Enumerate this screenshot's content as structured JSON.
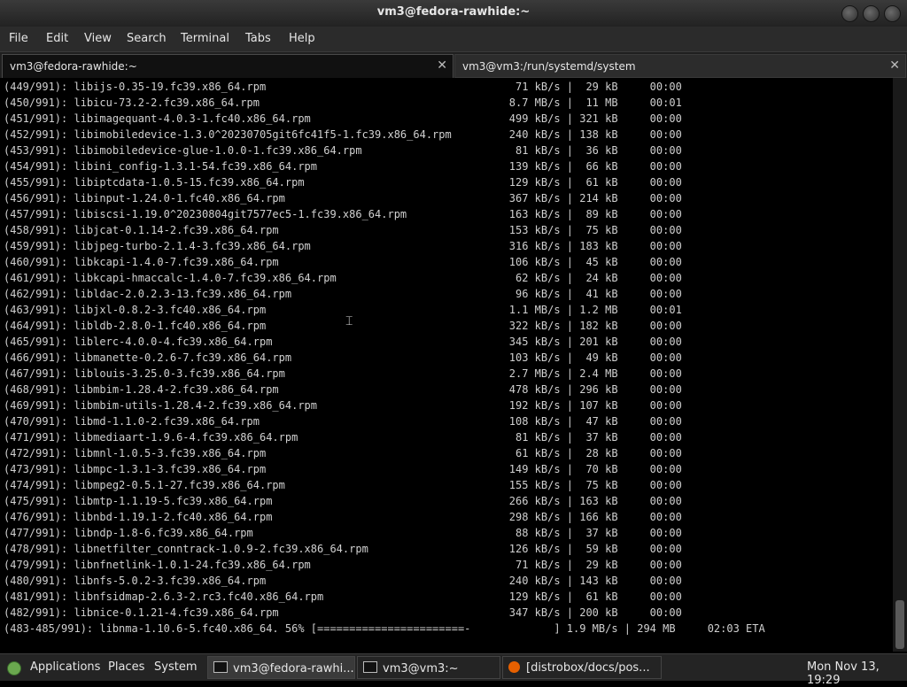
{
  "window": {
    "title": "vm3@fedora-rawhide:~"
  },
  "menu": [
    "File",
    "Edit",
    "View",
    "Search",
    "Terminal",
    "Tabs",
    "Help"
  ],
  "tabs": [
    {
      "label": "vm3@fedora-rawhide:~",
      "close": "✕"
    },
    {
      "label": "vm3@vm3:/run/systemd/system",
      "close": "✕"
    }
  ],
  "terminal": {
    "lines": [
      "(449/991): libijs-0.35-19.fc39.x86_64.rpm                                       71 kB/s |  29 kB     00:00",
      "(450/991): libicu-73.2-2.fc39.x86_64.rpm                                       8.7 MB/s |  11 MB     00:01",
      "(451/991): libimagequant-4.0.3-1.fc40.x86_64.rpm                               499 kB/s | 321 kB     00:00",
      "(452/991): libimobiledevice-1.3.0^20230705git6fc41f5-1.fc39.x86_64.rpm         240 kB/s | 138 kB     00:00",
      "(453/991): libimobiledevice-glue-1.0.0-1.fc39.x86_64.rpm                        81 kB/s |  36 kB     00:00",
      "(454/991): libini_config-1.3.1-54.fc39.x86_64.rpm                              139 kB/s |  66 kB     00:00",
      "(455/991): libiptcdata-1.0.5-15.fc39.x86_64.rpm                                129 kB/s |  61 kB     00:00",
      "(456/991): libinput-1.24.0-1.fc40.x86_64.rpm                                   367 kB/s | 214 kB     00:00",
      "(457/991): libiscsi-1.19.0^20230804git7577ec5-1.fc39.x86_64.rpm                163 kB/s |  89 kB     00:00",
      "(458/991): libjcat-0.1.14-2.fc39.x86_64.rpm                                    153 kB/s |  75 kB     00:00",
      "(459/991): libjpeg-turbo-2.1.4-3.fc39.x86_64.rpm                               316 kB/s | 183 kB     00:00",
      "(460/991): libkcapi-1.4.0-7.fc39.x86_64.rpm                                    106 kB/s |  45 kB     00:00",
      "(461/991): libkcapi-hmaccalc-1.4.0-7.fc39.x86_64.rpm                            62 kB/s |  24 kB     00:00",
      "(462/991): libldac-2.0.2.3-13.fc39.x86_64.rpm                                   96 kB/s |  41 kB     00:00",
      "(463/991): libjxl-0.8.2-3.fc40.x86_64.rpm                                      1.1 MB/s | 1.2 MB     00:01",
      "(464/991): libldb-2.8.0-1.fc40.x86_64.rpm                                      322 kB/s | 182 kB     00:00",
      "(465/991): liblerc-4.0.0-4.fc39.x86_64.rpm                                     345 kB/s | 201 kB     00:00",
      "(466/991): libmanette-0.2.6-7.fc39.x86_64.rpm                                  103 kB/s |  49 kB     00:00",
      "(467/991): liblouis-3.25.0-3.fc39.x86_64.rpm                                   2.7 MB/s | 2.4 MB     00:00",
      "(468/991): libmbim-1.28.4-2.fc39.x86_64.rpm                                    478 kB/s | 296 kB     00:00",
      "(469/991): libmbim-utils-1.28.4-2.fc39.x86_64.rpm                              192 kB/s | 107 kB     00:00",
      "(470/991): libmd-1.1.0-2.fc39.x86_64.rpm                                       108 kB/s |  47 kB     00:00",
      "(471/991): libmediaart-1.9.6-4.fc39.x86_64.rpm                                  81 kB/s |  37 kB     00:00",
      "(472/991): libmnl-1.0.5-3.fc39.x86_64.rpm                                       61 kB/s |  28 kB     00:00",
      "(473/991): libmpc-1.3.1-3.fc39.x86_64.rpm                                      149 kB/s |  70 kB     00:00",
      "(474/991): libmpeg2-0.5.1-27.fc39.x86_64.rpm                                   155 kB/s |  75 kB     00:00",
      "(475/991): libmtp-1.1.19-5.fc39.x86_64.rpm                                     266 kB/s | 163 kB     00:00",
      "(476/991): libnbd-1.19.1-2.fc40.x86_64.rpm                                     298 kB/s | 166 kB     00:00",
      "(477/991): libndp-1.8-6.fc39.x86_64.rpm                                         88 kB/s |  37 kB     00:00",
      "(478/991): libnetfilter_conntrack-1.0.9-2.fc39.x86_64.rpm                      126 kB/s |  59 kB     00:00",
      "(479/991): libnfnetlink-1.0.1-24.fc39.x86_64.rpm                                71 kB/s |  29 kB     00:00",
      "(480/991): libnfs-5.0.2-3.fc39.x86_64.rpm                                      240 kB/s | 143 kB     00:00",
      "(481/991): libnfsidmap-2.6.3-2.rc3.fc40.x86_64.rpm                             129 kB/s |  61 kB     00:00",
      "(482/991): libnice-0.1.21-4.fc39.x86_64.rpm                                    347 kB/s | 200 kB     00:00",
      "(483-485/991): libnma-1.10.6-5.fc40.x86_64. 56% [=======================-             ] 1.9 MB/s | 294 MB     02:03 ETA"
    ]
  },
  "taskbar": {
    "menus": [
      "Applications",
      "Places",
      "System"
    ],
    "windows": [
      "vm3@fedora-rawhi...",
      "vm3@vm3:~",
      "[distrobox/docs/pos..."
    ],
    "clock": "Mon Nov 13, 19:29"
  }
}
